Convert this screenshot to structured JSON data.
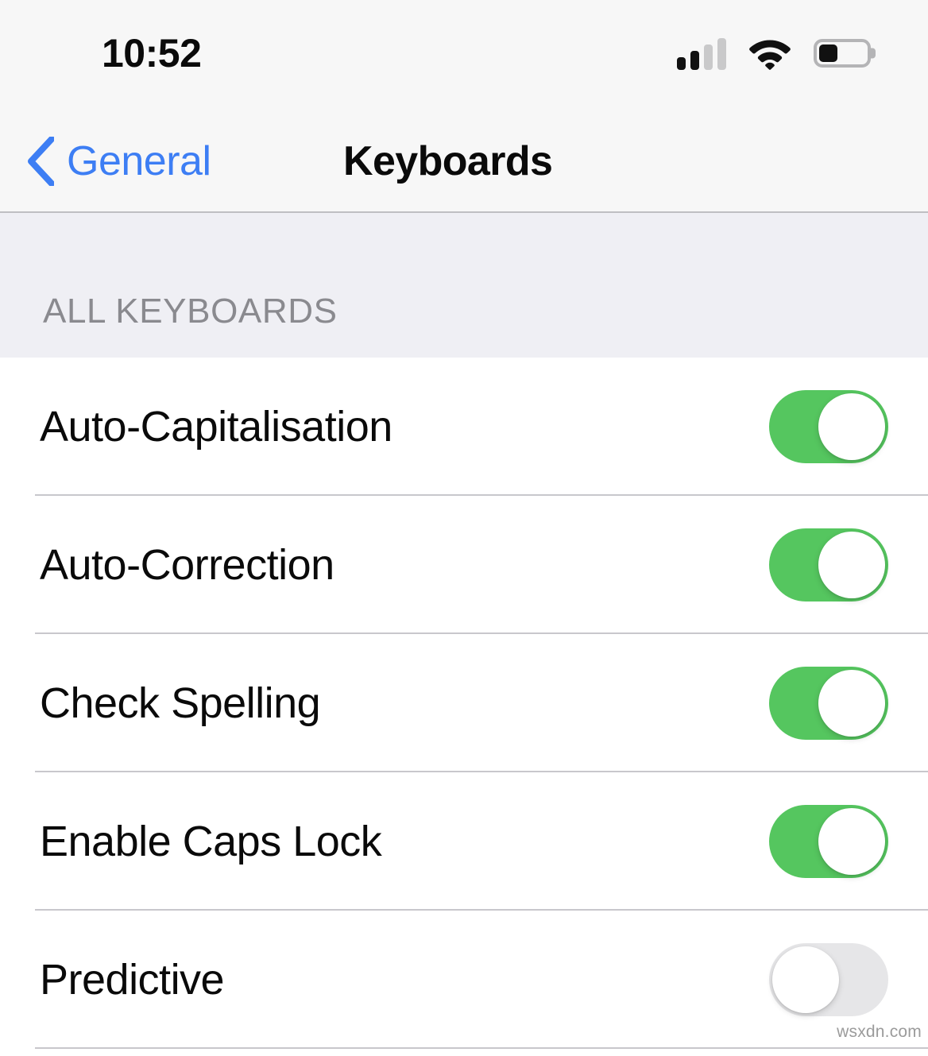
{
  "status_bar": {
    "time": "10:52",
    "signal_icon": "cellular-signal-icon",
    "signal_bars_total": 4,
    "signal_bars_filled": 2,
    "wifi_icon": "wifi-icon",
    "wifi_strength": "full",
    "battery_icon": "battery-icon",
    "battery_percent": 40
  },
  "nav": {
    "back_icon": "chevron-left-icon",
    "back_label": "General",
    "title": "Keyboards"
  },
  "section": {
    "header": "ALL KEYBOARDS"
  },
  "rows": [
    {
      "label": "Auto-Capitalisation",
      "toggle": "on",
      "toggle_name": "toggle-auto-capitalisation"
    },
    {
      "label": "Auto-Correction",
      "toggle": "on",
      "toggle_name": "toggle-auto-correction"
    },
    {
      "label": "Check Spelling",
      "toggle": "on",
      "toggle_name": "toggle-check-spelling"
    },
    {
      "label": "Enable Caps Lock",
      "toggle": "on",
      "toggle_name": "toggle-enable-caps-lock"
    },
    {
      "label": "Predictive",
      "toggle": "off",
      "toggle_name": "toggle-predictive"
    }
  ],
  "watermark": "wsxdn.com",
  "colors": {
    "accent_blue": "#3d7ef4",
    "toggle_on": "#55c65f",
    "toggle_off": "#e6e6e8",
    "section_bg": "#efeff4",
    "bar_bg": "#f7f7f7",
    "separator": "#c8c7cc",
    "section_label": "#8a8a8f"
  }
}
